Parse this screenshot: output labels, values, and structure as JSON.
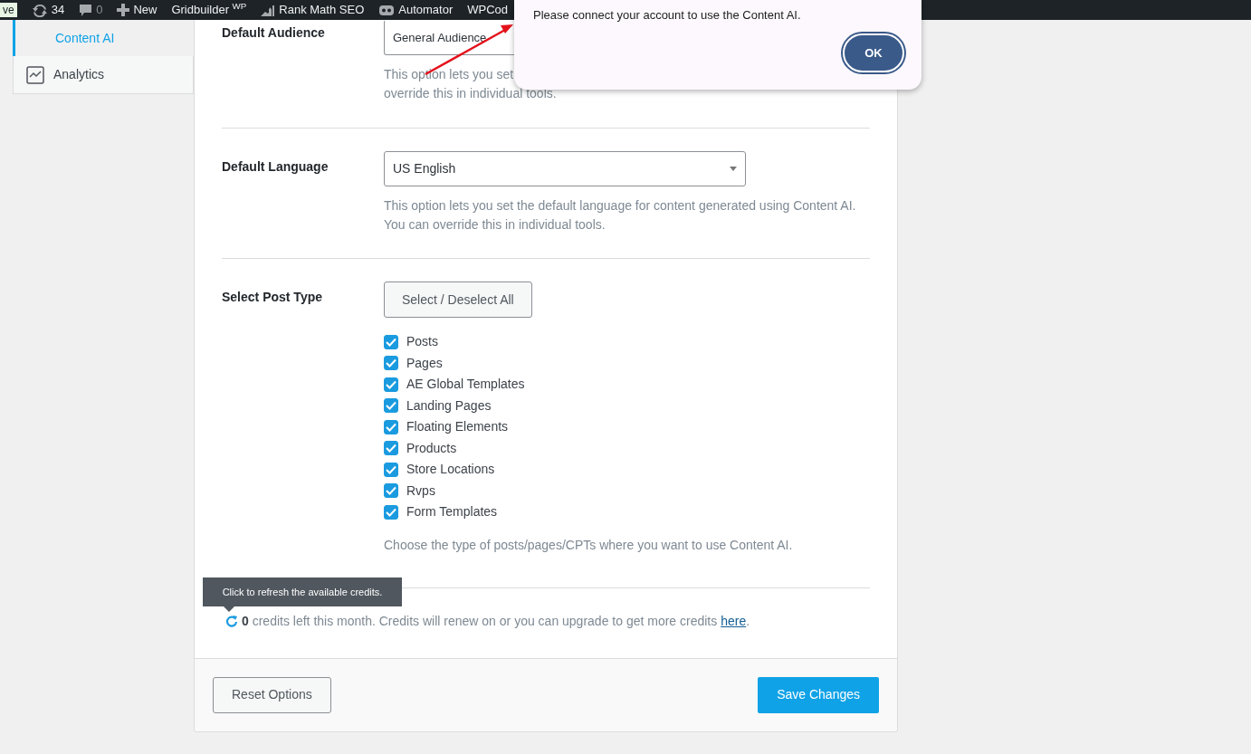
{
  "admin_bar": {
    "items": [
      {
        "kind": "badge",
        "label": "ve"
      },
      {
        "kind": "updates",
        "label": "34"
      },
      {
        "kind": "comments",
        "label": "0"
      },
      {
        "kind": "new",
        "label": "New"
      },
      {
        "kind": "text",
        "label": "Gridbuilder $^{WP}$"
      },
      {
        "kind": "rankmath",
        "label": "Rank Math SEO"
      },
      {
        "kind": "automator",
        "label": "Automator"
      },
      {
        "kind": "text",
        "label": "WPCod"
      }
    ]
  },
  "side_tabs": [
    {
      "kind": "plain",
      "label": "Content AI",
      "selected": true
    },
    {
      "kind": "analytics",
      "label": "Analytics",
      "selected": false
    }
  ],
  "settings": [
    {
      "kind": "select",
      "label": "Default Audience",
      "value": "General Audience",
      "description": [
        "This option lets you set",
        "override this in individual tools."
      ]
    },
    {
      "kind": "select",
      "label": "Default Language",
      "value": "US English",
      "description": [
        "This option lets you set the default language for content generated using Content AI.",
        "You can override this in individual tools."
      ]
    },
    {
      "kind": "checklist",
      "label": "Select Post Type",
      "button": "Select / Deselect All",
      "options": [
        {
          "label": "Posts",
          "checked": true
        },
        {
          "label": "Pages",
          "checked": true
        },
        {
          "label": "AE Global Templates",
          "checked": true
        },
        {
          "label": "Landing Pages",
          "checked": true
        },
        {
          "label": "Floating Elements",
          "checked": true
        },
        {
          "label": "Products",
          "checked": true
        },
        {
          "label": "Store Locations",
          "checked": true
        },
        {
          "label": "Rvps",
          "checked": true
        },
        {
          "label": "Form Templates",
          "checked": true
        }
      ],
      "description": [
        "Choose the type of posts/pages/CPTs where you want to use Content AI."
      ]
    }
  ],
  "credits": {
    "tooltip": "Click to refresh the available credits.",
    "text": "**0** credits left this month. Credits will renew on or you can upgrade to get more credits ",
    "link": "here",
    "after": "."
  },
  "footer": {
    "reset": "Reset Options",
    "save": "Save Changes"
  },
  "dialog": {
    "message": "Please connect your account to use the Content AI.",
    "button": "OK"
  }
}
